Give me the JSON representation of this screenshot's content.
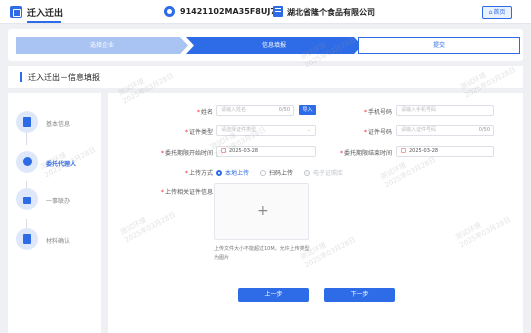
{
  "header": {
    "title": "迁入迁出",
    "credit_code": "91421102MA35F8UJ77",
    "company_name": "湖北省隆个食品有限公司",
    "home_label": "首页",
    "home_glyph": "⌂"
  },
  "steps": [
    "选择企业",
    "信息填报",
    "提交"
  ],
  "section_title": "迁入迁出－信息填报",
  "sidebar": {
    "items": [
      {
        "label": "基本信息",
        "icon": "document-icon"
      },
      {
        "label": "委托代理人",
        "icon": "person-icon"
      },
      {
        "label": "一事联办",
        "icon": "lock-icon"
      },
      {
        "label": "材料确认",
        "icon": "document-icon"
      }
    ]
  },
  "form": {
    "name_label": "姓名",
    "name_placeholder": "请输入姓名",
    "name_counter": "0/50",
    "import_label": "导入",
    "phone_label": "手机号码",
    "phone_placeholder": "请输入手机号码",
    "cert_type_label": "证件类型",
    "cert_type_placeholder": "请选择证件类型",
    "cert_no_label": "证件号码",
    "cert_no_placeholder": "请输入证件号码",
    "cert_no_counter": "0/50",
    "start_label": "委托期限开始时间",
    "start_value": "2025-03-28",
    "end_label": "委托期限结束时间",
    "end_value": "2025-03-28",
    "method_label": "上传方式",
    "method_options": [
      "本地上传",
      "扫码上传",
      "电子证照库"
    ],
    "upload_label": "上传相关证件信息",
    "upload_hint": "上传文件大小不能超过10M。允许上传类型为图片"
  },
  "buttons": {
    "prev": "上一步",
    "next": "下一步"
  },
  "watermark": {
    "line1": "测试环境",
    "line2": "2025年03月28日"
  },
  "colors": {
    "primary": "#2e6be6",
    "step_done": "#a9c3f3",
    "required": "#f5222d"
  }
}
